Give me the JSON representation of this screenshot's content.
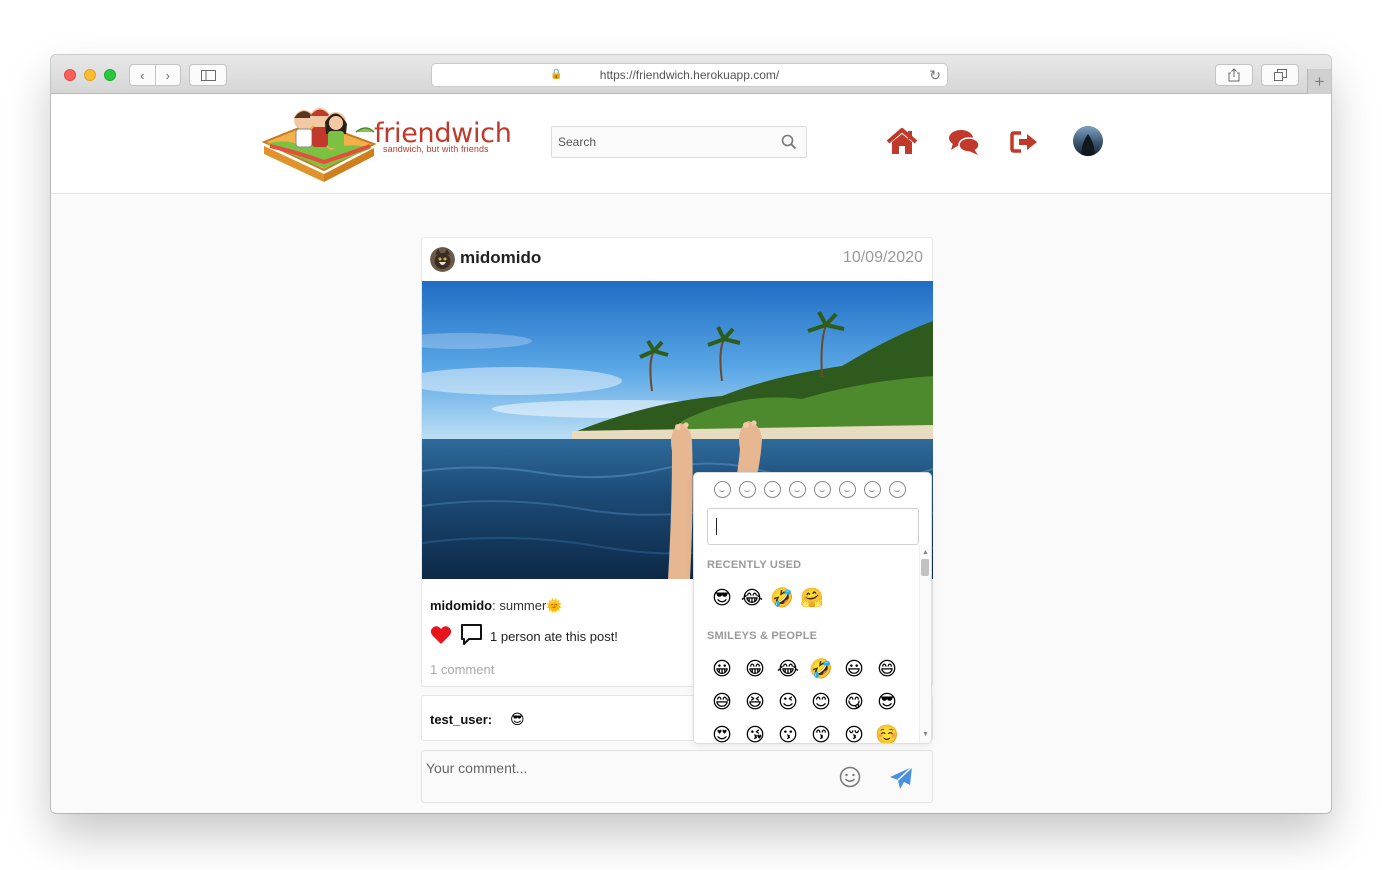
{
  "browser": {
    "url": "https://friendwich.herokuapp.com/"
  },
  "header": {
    "brand_name": "friendwich",
    "brand_tagline": "sandwich, but with friends",
    "search_placeholder": "Search"
  },
  "post": {
    "username": "midomido",
    "date": "10/09/2020",
    "caption_user": "midomido",
    "caption_text": ": summer🌞",
    "likes_text": "1 person ate this post!",
    "comment_count": "1 comment"
  },
  "comment": {
    "user": "test_user:",
    "text": "😎"
  },
  "composer": {
    "placeholder": "Your comment..."
  },
  "emoji_picker": {
    "section_recent": "RECENTLY USED",
    "section_smileys": "SMILEYS & PEOPLE",
    "recent": [
      "😎",
      "😂",
      "🤣",
      "🤗"
    ],
    "smileys_row1": [
      "😀",
      "😁",
      "😂",
      "🤣",
      "😃",
      "😄"
    ],
    "smileys_row2": [
      "😅",
      "😆",
      "😉",
      "😊",
      "😋",
      "😎"
    ],
    "smileys_row3": [
      "😍",
      "😘",
      "😗",
      "😙",
      "😚",
      "☺️"
    ]
  },
  "colors": {
    "brand_red": "#c0392b",
    "send_blue": "#4a90e2",
    "heart_red": "#e8141b"
  }
}
